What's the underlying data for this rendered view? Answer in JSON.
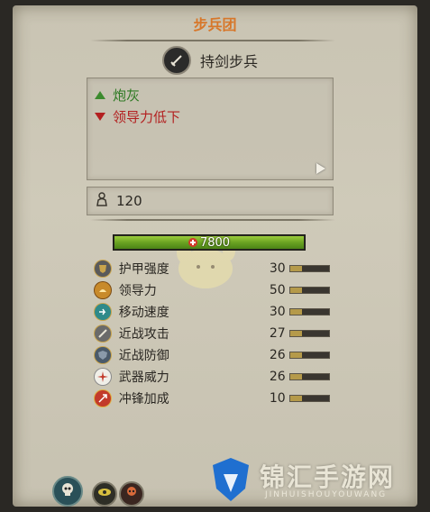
{
  "panel": {
    "title": "步兵团"
  },
  "unit": {
    "name": "持剑步兵",
    "icon": "sword-icon"
  },
  "traits": [
    {
      "label": "炮灰",
      "type": "positive",
      "icon": "triangle-up-icon"
    },
    {
      "label": "领导力低下",
      "type": "negative",
      "icon": "triangle-down-icon"
    }
  ],
  "men": {
    "count": "120",
    "icon": "soldier-icon"
  },
  "health": {
    "value": "7800",
    "fraction": 1.0,
    "icon": "health-cross-icon"
  },
  "stats": [
    {
      "label": "护甲强度",
      "value": "30",
      "fraction": 0.3,
      "icon": "armor-icon"
    },
    {
      "label": "领导力",
      "value": "50",
      "fraction": 0.3,
      "icon": "leadership-icon"
    },
    {
      "label": "移动速度",
      "value": "30",
      "fraction": 0.3,
      "icon": "speed-icon"
    },
    {
      "label": "近战攻击",
      "value": "27",
      "fraction": 0.3,
      "icon": "melee-attack-icon"
    },
    {
      "label": "近战防御",
      "value": "26",
      "fraction": 0.3,
      "icon": "melee-defence-icon"
    },
    {
      "label": "武器威力",
      "value": "26",
      "fraction": 0.3,
      "icon": "weapon-strength-icon"
    },
    {
      "label": "冲锋加成",
      "value": "10",
      "fraction": 0.3,
      "icon": "charge-bonus-icon"
    }
  ],
  "bottom_buttons": [
    {
      "name": "skull-abilities",
      "icon": "skull-icon"
    },
    {
      "name": "eye-ability",
      "icon": "eye-icon"
    },
    {
      "name": "skull-red-ability",
      "icon": "skull-icon"
    }
  ],
  "watermark": {
    "title": "锦汇手游网",
    "subtitle": "JINHUISHOUYOUWANG"
  },
  "colors": {
    "title": "#d7772a",
    "positive": "#2f7a24",
    "negative": "#b32020",
    "health": "#6aa322"
  }
}
